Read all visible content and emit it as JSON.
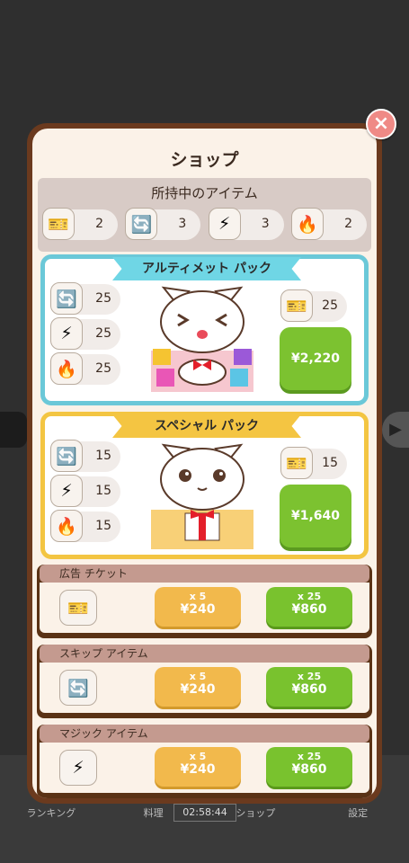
{
  "background": {
    "tabs": [
      "ランキング",
      "料理",
      "ショップ",
      "設定"
    ],
    "timer": "02:58:44"
  },
  "shop": {
    "title": "ショップ",
    "close_icon": "×",
    "owned": {
      "title": "所持中のアイテム",
      "items": [
        {
          "icon": "skip-ticket-icon",
          "glyph": "🎫",
          "count": "2"
        },
        {
          "icon": "swap-icon",
          "glyph": "🔄",
          "count": "3"
        },
        {
          "icon": "lightning-icon",
          "glyph": "⚡",
          "count": "3"
        },
        {
          "icon": "fire-icon",
          "glyph": "🔥",
          "count": "2"
        }
      ]
    },
    "packs": [
      {
        "name": "アルティメット パック",
        "items": [
          {
            "icon": "swap-icon",
            "glyph": "🔄",
            "count": "25"
          },
          {
            "icon": "lightning-icon",
            "glyph": "⚡",
            "count": "25"
          },
          {
            "icon": "fire-icon",
            "glyph": "🔥",
            "count": "25"
          }
        ],
        "skip": {
          "icon": "skip-ticket-icon",
          "glyph": "🎫",
          "count": "25"
        },
        "price": "¥2,220"
      },
      {
        "name": "スペシャル パック",
        "items": [
          {
            "icon": "swap-icon",
            "glyph": "🔄",
            "count": "15"
          },
          {
            "icon": "lightning-icon",
            "glyph": "⚡",
            "count": "15"
          },
          {
            "icon": "fire-icon",
            "glyph": "🔥",
            "count": "15"
          }
        ],
        "skip": {
          "icon": "skip-ticket-icon",
          "glyph": "🎫",
          "count": "15"
        },
        "price": "¥1,640"
      }
    ],
    "item_rows": [
      {
        "label": "広告 チケット",
        "icon": "skip-ticket-icon",
        "glyph": "🎫",
        "small_qty": "x 5",
        "small_price": "¥240",
        "large_qty": "x 25",
        "large_price": "¥860"
      },
      {
        "label": "スキップ アイテム",
        "icon": "swap-icon",
        "glyph": "🔄",
        "small_qty": "x 5",
        "small_price": "¥240",
        "large_qty": "x 25",
        "large_price": "¥860"
      },
      {
        "label": "マジック アイテム",
        "icon": "lightning-icon",
        "glyph": "⚡",
        "small_qty": "x 5",
        "small_price": "¥240",
        "large_qty": "x 25",
        "large_price": "¥860"
      }
    ]
  }
}
